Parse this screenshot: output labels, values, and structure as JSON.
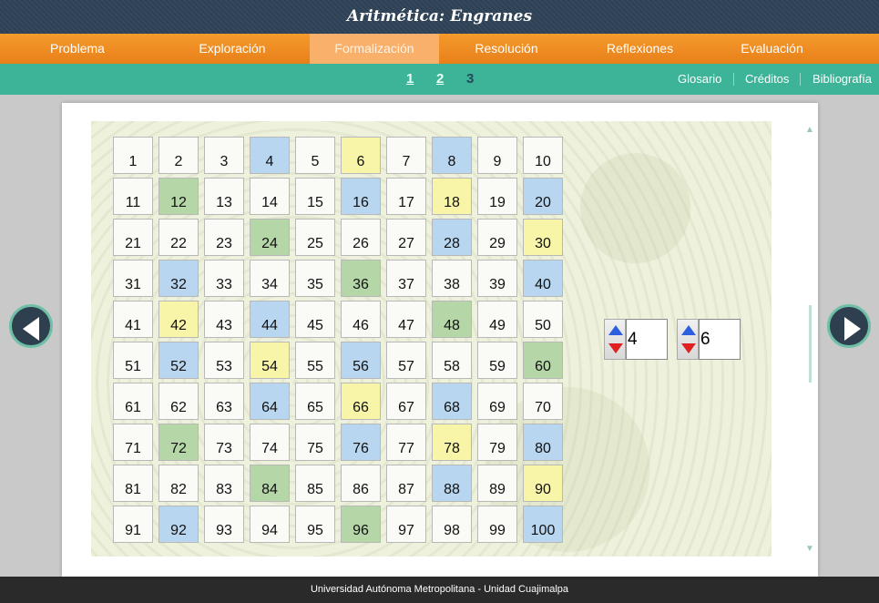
{
  "app_title": "Aritmética: Engranes",
  "nav": {
    "tabs": [
      {
        "label": "Problema"
      },
      {
        "label": "Exploración"
      },
      {
        "label": "Formalización"
      },
      {
        "label": "Resolución"
      },
      {
        "label": "Reflexiones"
      },
      {
        "label": "Evaluación"
      }
    ],
    "active_tab": "Formalización"
  },
  "subnav": {
    "pages": [
      "1",
      "2",
      "3"
    ],
    "current_page": "3",
    "links": [
      "Glosario",
      "Créditos",
      "Bibliografía"
    ]
  },
  "grid": {
    "numbers": [
      1,
      2,
      3,
      4,
      5,
      6,
      7,
      8,
      9,
      10,
      11,
      12,
      13,
      14,
      15,
      16,
      17,
      18,
      19,
      20,
      21,
      22,
      23,
      24,
      25,
      26,
      27,
      28,
      29,
      30,
      31,
      32,
      33,
      34,
      35,
      36,
      37,
      38,
      39,
      40,
      41,
      42,
      43,
      44,
      45,
      46,
      47,
      48,
      49,
      50,
      51,
      52,
      53,
      54,
      55,
      56,
      57,
      58,
      59,
      60,
      61,
      62,
      63,
      64,
      65,
      66,
      67,
      68,
      69,
      70,
      71,
      72,
      73,
      74,
      75,
      76,
      77,
      78,
      79,
      80,
      81,
      82,
      83,
      84,
      85,
      86,
      87,
      88,
      89,
      90,
      91,
      92,
      93,
      94,
      95,
      96,
      97,
      98,
      99,
      100
    ],
    "colors": {
      "blue": [
        4,
        8,
        16,
        20,
        28,
        32,
        40,
        44,
        52,
        56,
        64,
        68,
        76,
        80,
        88,
        92,
        100
      ],
      "yellow": [
        6,
        18,
        30,
        42,
        54,
        66,
        78,
        90
      ],
      "green": [
        12,
        24,
        36,
        48,
        60,
        72,
        84,
        96
      ]
    },
    "palette": {
      "blue": "#b8d6ef",
      "yellow": "#f9f5a8",
      "green": "#b5d6a7"
    }
  },
  "spinners": {
    "first": {
      "value": "4",
      "up_icon": "arrow-up-icon",
      "down_icon": "arrow-down-icon"
    },
    "second": {
      "value": "6",
      "up_icon": "arrow-up-icon",
      "down_icon": "arrow-down-icon"
    }
  },
  "navigation": {
    "prev_icon": "chevron-left-icon",
    "next_icon": "chevron-right-icon"
  },
  "footer": {
    "text": "Universidad Autónoma Metropolitana - Unidad Cuajimalpa"
  },
  "colors": {
    "header_bg": "#2f4257",
    "nav_orange": "#f59a2c",
    "subnav_teal": "#3db497"
  }
}
